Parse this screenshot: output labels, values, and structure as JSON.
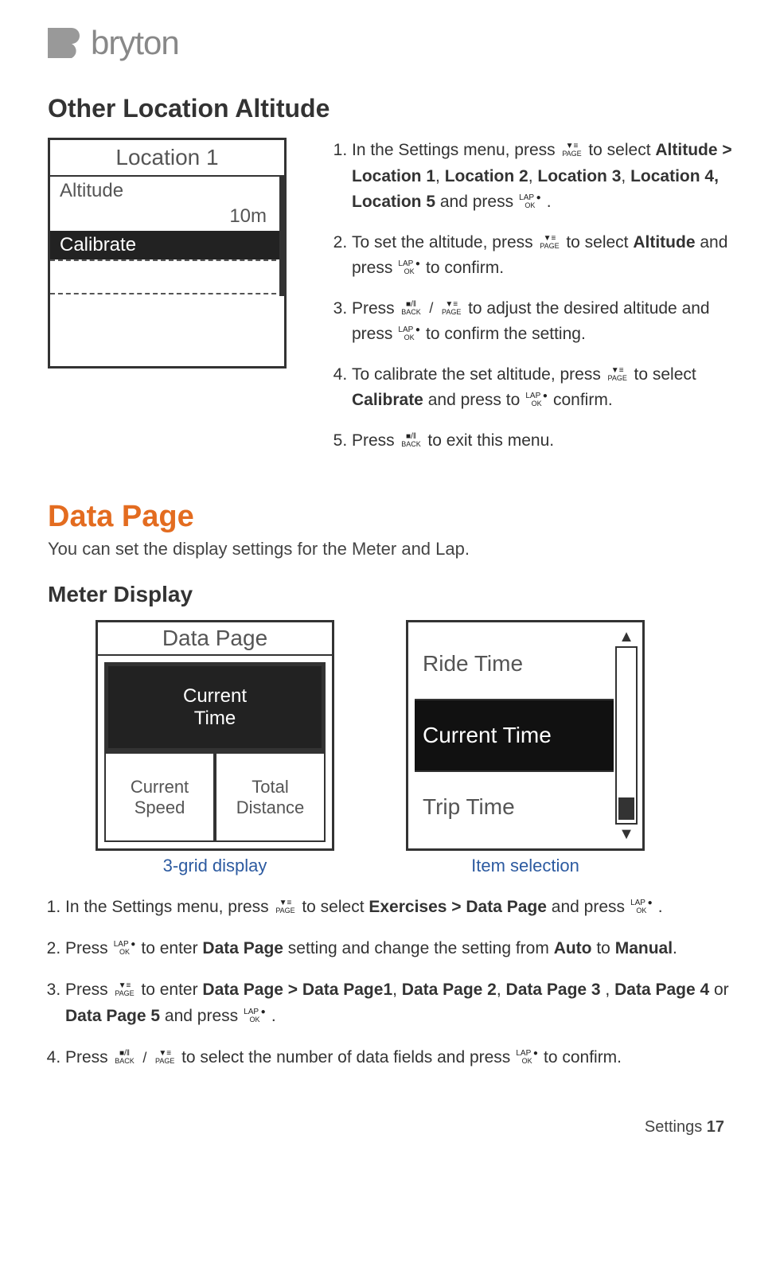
{
  "brand": "bryton",
  "section1": {
    "heading": "Other Location Altitude",
    "device": {
      "title": "Location 1",
      "altitude_label": "Altitude",
      "altitude_value": "10m",
      "calibrate_label": "Calibrate"
    },
    "steps": [
      {
        "pre": "In the Settings menu, press ",
        "post": " to select ",
        "bold1": "Altitude > Location 1",
        "mid1": ", ",
        "bold2": "Location 2",
        "mid2": ", ",
        "bold3": "Location 3",
        "mid3": ", ",
        "bold4": "Location 4, Location 5",
        "mid4": " and press ",
        "post2": " ."
      },
      {
        "pre": "To set the altitude, press ",
        "post": " to select ",
        "bold1": "Altitude",
        "mid1": " and press ",
        "tail": " to confirm."
      },
      {
        "pre": "Press ",
        "mid": " to adjust the desired altitude and press ",
        "tail": " to confirm the setting."
      },
      {
        "pre": "To calibrate the set altitude, press ",
        "mid": " to select ",
        "bold1": "Calibrate",
        "mid2": " and press to ",
        "tail": " confirm."
      },
      {
        "pre": "Press ",
        "tail": " to exit this menu."
      }
    ]
  },
  "section2": {
    "heading": "Data Page",
    "intro": "You can set the display settings for the Meter and Lap.",
    "subheading": "Meter Display",
    "device_left": {
      "title": "Data Page",
      "big": "Current\nTime",
      "small1": "Current Speed",
      "small2": "Total Distance",
      "caption": "3-grid display"
    },
    "device_right": {
      "row1": "Ride Time",
      "row2": "Current Time",
      "row3": "Trip Time",
      "caption": "Item selection"
    },
    "steps": [
      {
        "pre": "In the Settings menu, press ",
        "mid": " to select ",
        "bold1": "Exercises > Data Page",
        "mid2": " and press ",
        "tail": " ."
      },
      {
        "pre": "Press ",
        "mid": " to enter ",
        "bold1": "Data Page",
        "mid2": " setting and change the setting from ",
        "bold2": "Auto",
        "mid3": " to ",
        "bold3": "Manual",
        "tail": "."
      },
      {
        "pre": "Press ",
        "mid": " to enter ",
        "bold1": "Data Page > Data Page1",
        "mid2": ", ",
        "bold2": "Data Page 2",
        "mid3": ", ",
        "bold3": "Data Page 3",
        "mid4": " , ",
        "bold4": "Data Page 4",
        "mid5": " or ",
        "bold5": "Data Page 5",
        "mid6": " and press ",
        "tail": "."
      },
      {
        "pre": "Press ",
        "mid": " to select the number of data fields and press ",
        "tail": " to confirm."
      }
    ]
  },
  "buttons": {
    "page_top": "▼≡",
    "page_bot": "PAGE",
    "lap_top": "LAP ●",
    "lap_bot": "OK",
    "back_top": "■/‖",
    "back_bot": "BACK"
  },
  "footer": {
    "label": "Settings",
    "page": "17"
  }
}
